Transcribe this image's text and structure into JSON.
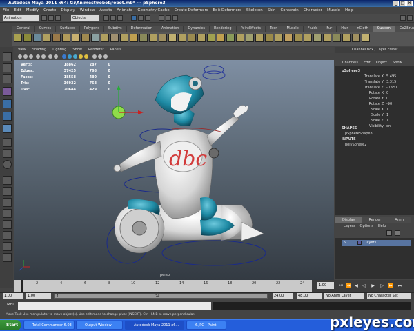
{
  "window": {
    "title": "Autodesk Maya 2011 x64: G:\\Animest\\robot\\robot.mb*  ---  pSphere3",
    "buttons": [
      "_",
      "□",
      "×"
    ]
  },
  "menu_bar": [
    "File",
    "Edit",
    "Modify",
    "Create",
    "Display",
    "Window",
    "Assets",
    "Animate",
    "Geometry Cache",
    "Create Deformers",
    "Edit Deformers",
    "Skeleton",
    "Skin",
    "Constrain",
    "Character",
    "Muscle",
    "Help"
  ],
  "status_line": {
    "mode": "Animation",
    "selection_field": "Objects"
  },
  "shelf_tabs": [
    "General",
    "Curves",
    "Surfaces",
    "Polygons",
    "Subdivs",
    "Deformation",
    "Animation",
    "Dynamics",
    "Rendering",
    "PaintEffects",
    "Toon",
    "Muscle",
    "Fluids",
    "Fur",
    "Hair",
    "nCloth",
    "Custom",
    "GoZBrush"
  ],
  "shelf_active": "Custom",
  "panel_menu": [
    "View",
    "Shading",
    "Lighting",
    "Show",
    "Renderer",
    "Panels"
  ],
  "hud": [
    {
      "label": "Verts:",
      "a": "18862",
      "b": "287",
      "c": "0"
    },
    {
      "label": "Edges:",
      "a": "37425",
      "b": "768",
      "c": "0"
    },
    {
      "label": "Faces:",
      "a": "18558",
      "b": "480",
      "c": "0"
    },
    {
      "label": "Tris:",
      "a": "36932",
      "b": "768",
      "c": "0"
    },
    {
      "label": "UVs:",
      "a": "20644",
      "b": "429",
      "c": "0"
    }
  ],
  "viewport_label": "persp",
  "channel_box": {
    "header": "Channel Box / Layer Editor",
    "menu": [
      "Channels",
      "Edit",
      "Object",
      "Show"
    ],
    "object": "pSphere3",
    "channels": [
      {
        "name": "Translate X",
        "value": "5.495"
      },
      {
        "name": "Translate Y",
        "value": "3.315"
      },
      {
        "name": "Translate Z",
        "value": "-0.951"
      },
      {
        "name": "Rotate X",
        "value": "0"
      },
      {
        "name": "Rotate Y",
        "value": "0"
      },
      {
        "name": "Rotate Z",
        "value": "-90"
      },
      {
        "name": "Scale X",
        "value": "1"
      },
      {
        "name": "Scale Y",
        "value": "1"
      },
      {
        "name": "Scale Z",
        "value": "1"
      },
      {
        "name": "Visibility",
        "value": "on"
      }
    ],
    "shapes_title": "SHAPES",
    "shape": "pSphereShape3",
    "inputs_title": "INPUTS",
    "input": "polySphere2"
  },
  "layer_editor": {
    "tabs": [
      "Display",
      "Render",
      "Anim"
    ],
    "menu": [
      "Layers",
      "Options",
      "Help"
    ],
    "layer_v": "V",
    "layer_name": "layer1"
  },
  "timeline": {
    "ticks": [
      "2",
      "4",
      "6",
      "8",
      "10",
      "12",
      "14",
      "16",
      "18",
      "20",
      "22",
      "24"
    ],
    "current_frame": "1.00"
  },
  "range": {
    "start": "1.00",
    "start2": "1.00",
    "slider_start": "1",
    "slider_end": "24",
    "end": "24.00",
    "end2": "48.00",
    "anim_layer": "No Anim Layer",
    "char_set": "No Character Set"
  },
  "mel": {
    "label": "MEL"
  },
  "help_line": "Move Tool: Use manipulator to move object(s). Use edit mode to change pivot (INSERT). Ctrl+LMB to move perpendicular.",
  "taskbar": {
    "start": "Start",
    "tasks": [
      "Total Commander 6.03 - ...",
      "Output Window",
      "Autodesk Maya 2011 x6...",
      "6.JPG - Paint"
    ]
  },
  "logo_text": "dbc",
  "watermark": "pxleyes.com",
  "colors": {
    "accent": "#1e90a8",
    "selection": "#5874a0"
  }
}
